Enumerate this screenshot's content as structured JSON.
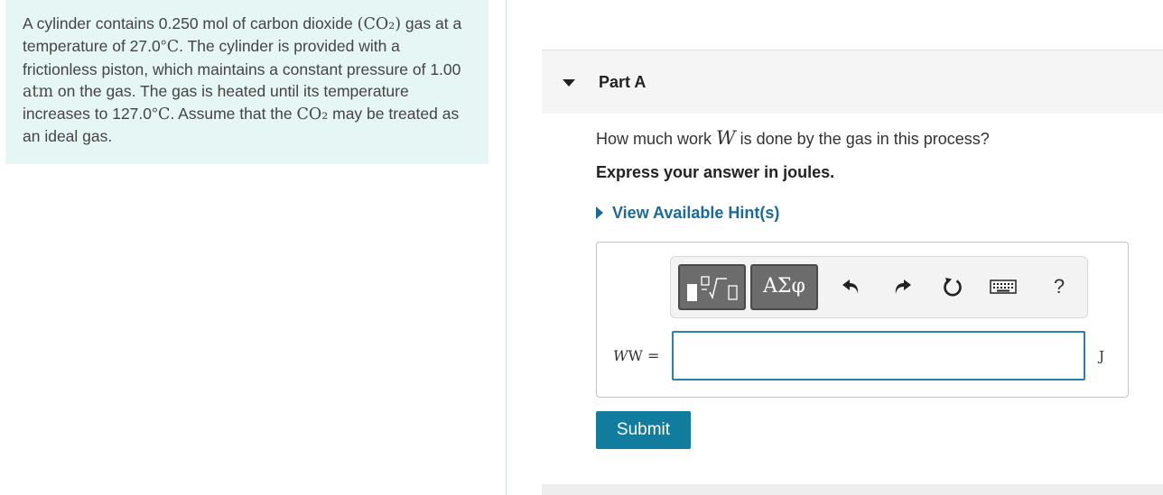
{
  "problem": {
    "segments": [
      {
        "text": "A cylinder contains 0.250 mol of carbon dioxide ",
        "math": false
      },
      {
        "text": "(CO₂)",
        "math": true
      },
      {
        "text": " gas at a temperature of 27.0°",
        "math": false
      },
      {
        "text": "C",
        "math": true
      },
      {
        "text": ". The cylinder is provided with a frictionless piston, which maintains a constant pressure of 1.00 ",
        "math": false
      },
      {
        "text": "atm",
        "math": true
      },
      {
        "text": " on the gas. The gas is heated until its temperature increases to 127.0°",
        "math": false
      },
      {
        "text": "C",
        "math": true
      },
      {
        "text": ". Assume that the ",
        "math": false
      },
      {
        "text": "CO₂",
        "math": true
      },
      {
        "text": " may be treated as an ideal gas.",
        "math": false
      }
    ]
  },
  "part": {
    "title": "Part A"
  },
  "question": {
    "before": "How much work ",
    "var": "W",
    "after": " is done by the gas in this process?"
  },
  "instruction": "Express your answer in joules.",
  "hint_link": "View Available Hint(s)",
  "toolbar": {
    "greek_label": "ΑΣφ",
    "icons": [
      "template-icon",
      "greek-symbols-icon",
      "undo-icon",
      "redo-icon",
      "reset-icon",
      "keyboard-icon",
      "help-icon"
    ],
    "help_label": "?"
  },
  "answer": {
    "label_var": "W",
    "label_rest": "W =",
    "value": "",
    "unit": "J"
  },
  "submit_label": "Submit",
  "colors": {
    "problem_bg": "#e6f6f5",
    "link": "#1a6a9c",
    "submit": "#127c9f",
    "input_border": "#2a7fb5"
  }
}
